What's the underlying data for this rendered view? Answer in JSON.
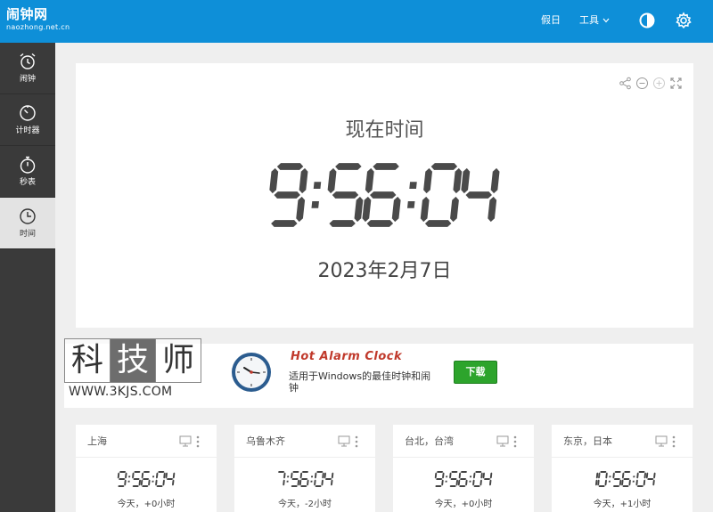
{
  "header": {
    "logo_title": "闹钟网",
    "logo_subtitle": "naozhong.net.cn",
    "nav_holiday": "假日",
    "nav_tools": "工具",
    "bar_color": "#0e8fd8"
  },
  "sidebar": {
    "items": [
      {
        "label": "闹钟",
        "icon": "alarm-clock-icon",
        "active": false
      },
      {
        "label": "计时器",
        "icon": "timer-icon",
        "active": false
      },
      {
        "label": "秒表",
        "icon": "stopwatch-icon",
        "active": false
      },
      {
        "label": "时间",
        "icon": "clock-icon",
        "active": true
      }
    ]
  },
  "clock": {
    "title": "现在时间",
    "time": "9:56:04",
    "date": "2023年2月7日",
    "tools": [
      "share-icon",
      "zoom-out-icon",
      "zoom-in-icon",
      "fullscreen-icon"
    ]
  },
  "ad": {
    "watermark_chars": [
      "科",
      "技",
      "师"
    ],
    "watermark_url": "WWW.3KJS.COM",
    "title": "Hot Alarm Clock",
    "description": "适用于Windows的最佳时钟和闹钟",
    "button_label": "下载"
  },
  "cities": [
    {
      "name": "上海",
      "time": "9:56:04",
      "offset": "今天，+0小时"
    },
    {
      "name": "乌鲁木齐",
      "time": "7:56:04",
      "offset": "今天，-2小时"
    },
    {
      "name": "台北，台湾",
      "time": "9:56:04",
      "offset": "今天，+0小时"
    },
    {
      "name": "东京，日本",
      "time": "10:56:04",
      "offset": "今天，+1小时"
    }
  ]
}
